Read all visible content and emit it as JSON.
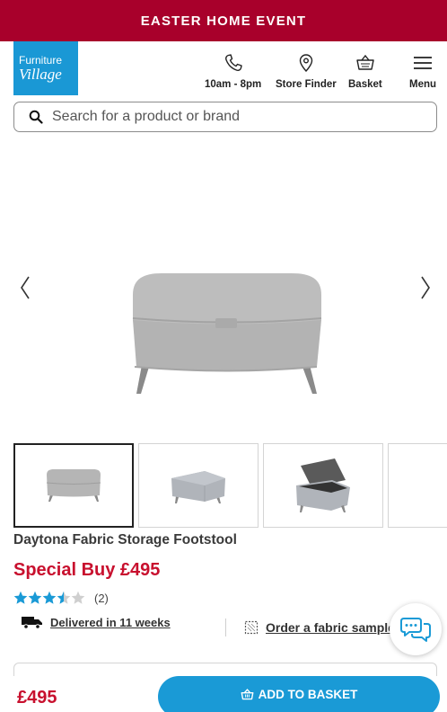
{
  "promo": {
    "text": "EASTER HOME EVENT"
  },
  "logo": {
    "line1": "Furniture",
    "line2": "Village"
  },
  "header": {
    "phone_label": "10am - 8pm",
    "store_label": "Store Finder",
    "basket_label": "Basket",
    "menu_label": "Menu"
  },
  "search": {
    "placeholder": "Search for a product or brand"
  },
  "product": {
    "title": "Daytona Fabric Storage Footstool",
    "price_line": "Special Buy £495",
    "rating": 3.5,
    "rating_max": 5,
    "review_count": "(2)",
    "delivery_text": "Delivered in 11 weeks",
    "sample_text": "Order a fabric sample"
  },
  "bottom_bar": {
    "price": "£495",
    "add_label": "ADD TO BASKET"
  },
  "colors": {
    "brand_red": "#a8002b",
    "price_red": "#c8102e",
    "accent_blue": "#1a9ad6",
    "star": "#1a9ad6"
  }
}
